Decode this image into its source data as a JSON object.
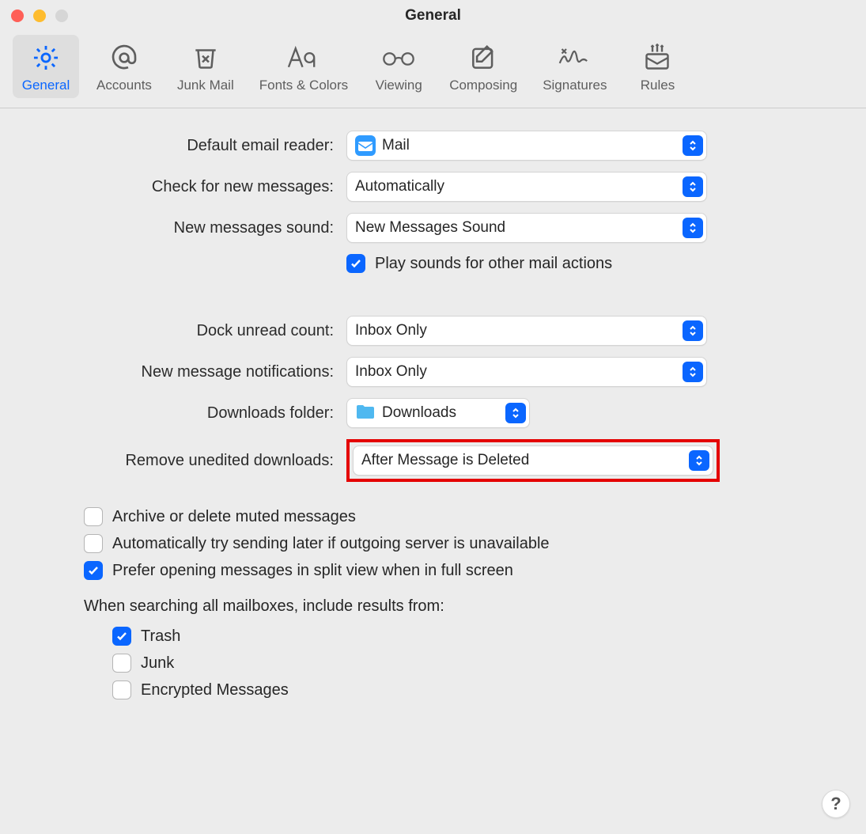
{
  "window": {
    "title": "General"
  },
  "toolbar": {
    "items": [
      {
        "label": "General"
      },
      {
        "label": "Accounts"
      },
      {
        "label": "Junk Mail"
      },
      {
        "label": "Fonts & Colors"
      },
      {
        "label": "Viewing"
      },
      {
        "label": "Composing"
      },
      {
        "label": "Signatures"
      },
      {
        "label": "Rules"
      }
    ]
  },
  "labels": {
    "default_reader": "Default email reader:",
    "check_messages": "Check for new messages:",
    "new_sound": "New messages sound:",
    "play_sounds": "Play sounds for other mail actions",
    "dock_unread": "Dock unread count:",
    "notifications": "New message notifications:",
    "downloads_folder": "Downloads folder:",
    "remove_downloads": "Remove unedited downloads:",
    "archive_muted": "Archive or delete muted messages",
    "auto_resend": "Automatically try sending later if outgoing server is unavailable",
    "split_view": "Prefer opening messages in split view when in full screen",
    "search_heading": "When searching all mailboxes, include results from:",
    "trash": "Trash",
    "junk": "Junk",
    "encrypted": "Encrypted Messages"
  },
  "values": {
    "default_reader": "Mail",
    "check_messages": "Automatically",
    "new_sound": "New Messages Sound",
    "dock_unread": "Inbox Only",
    "notifications": "Inbox Only",
    "downloads_folder": "Downloads",
    "remove_downloads": "After Message is Deleted"
  },
  "checks": {
    "play_sounds": true,
    "archive_muted": false,
    "auto_resend": false,
    "split_view": true,
    "trash": true,
    "junk": false,
    "encrypted": false
  },
  "help": "?"
}
